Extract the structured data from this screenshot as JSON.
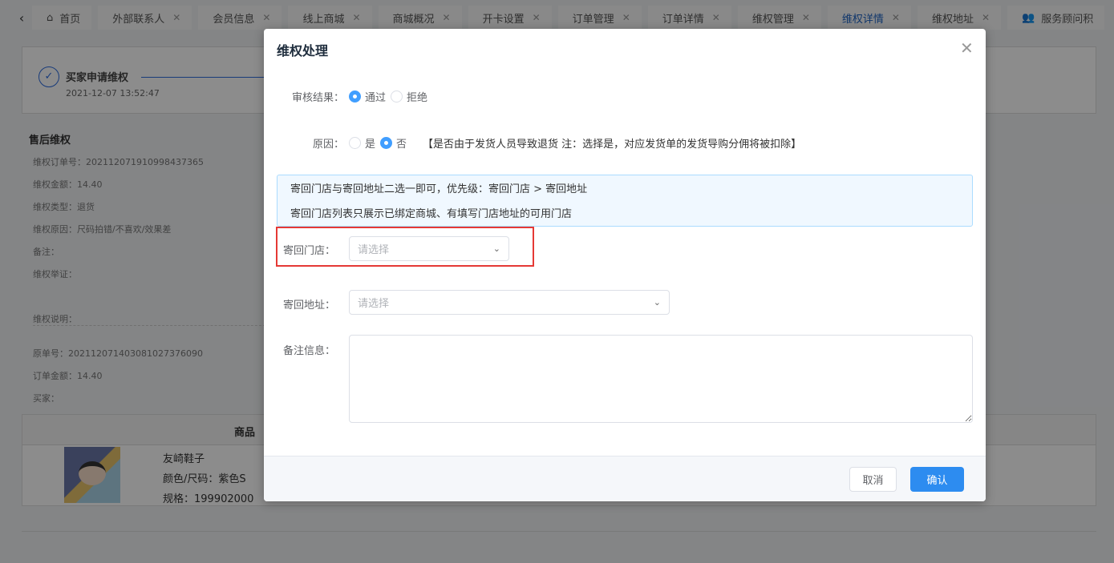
{
  "tabs": [
    {
      "label": "首页",
      "icon": "home-icon",
      "closable": false
    },
    {
      "label": "外部联系人",
      "closable": true
    },
    {
      "label": "会员信息",
      "closable": true
    },
    {
      "label": "线上商城",
      "closable": true
    },
    {
      "label": "商城概况",
      "closable": true
    },
    {
      "label": "开卡设置",
      "closable": true
    },
    {
      "label": "订单管理",
      "closable": true
    },
    {
      "label": "订单详情",
      "closable": true
    },
    {
      "label": "维权管理",
      "closable": true
    },
    {
      "label": "维权详情",
      "closable": true,
      "active": true
    },
    {
      "label": "维权地址",
      "closable": true
    },
    {
      "label": "服务顾问积",
      "icon": "users-icon",
      "closable": false
    }
  ],
  "step": {
    "title": "买家申请维权",
    "time": "2021-12-07 13:52:47"
  },
  "detail": {
    "title": "售后维权",
    "rows": [
      "维权订单号：20211207191099843736​5",
      "维权金额：14.40",
      "维权类型：退货",
      "维权原因：尺码拍错/不喜欢/效果差",
      "备注：",
      "维权举证：",
      "维权说明："
    ],
    "rows2": [
      "原单号：20211207140308102737609​0",
      "订单金额：14.40",
      "买家："
    ]
  },
  "product": {
    "header": "商品",
    "name": "友崎鞋子",
    "color": "颜色/尺码：紫色S",
    "spec": "规格：199902000"
  },
  "dialog": {
    "title": "维权处理",
    "audit_label": "审核结果：",
    "audit_options": [
      "通过",
      "拒绝"
    ],
    "reason_label": "原因：",
    "reason_options": [
      "是",
      "否"
    ],
    "reason_note": "【是否由于发货人员导致退货 注：选择是，对应发货单的发货导购分佣将被扣除】",
    "tips": [
      "寄回门店与寄回地址二选一即可，优先级：寄回门店 > 寄回地址",
      "寄回门店列表只展示已绑定商城、有填写门店地址的可用门店"
    ],
    "store_label": "寄回门店：",
    "store_placeholder": "请选择",
    "address_label": "寄回地址：",
    "address_placeholder": "请选择",
    "remark_label": "备注信息：",
    "remark_value": "",
    "cancel": "取消",
    "confirm": "确认"
  },
  "colors": {
    "primary": "#2d8cf0",
    "highlight": "#e53935"
  }
}
